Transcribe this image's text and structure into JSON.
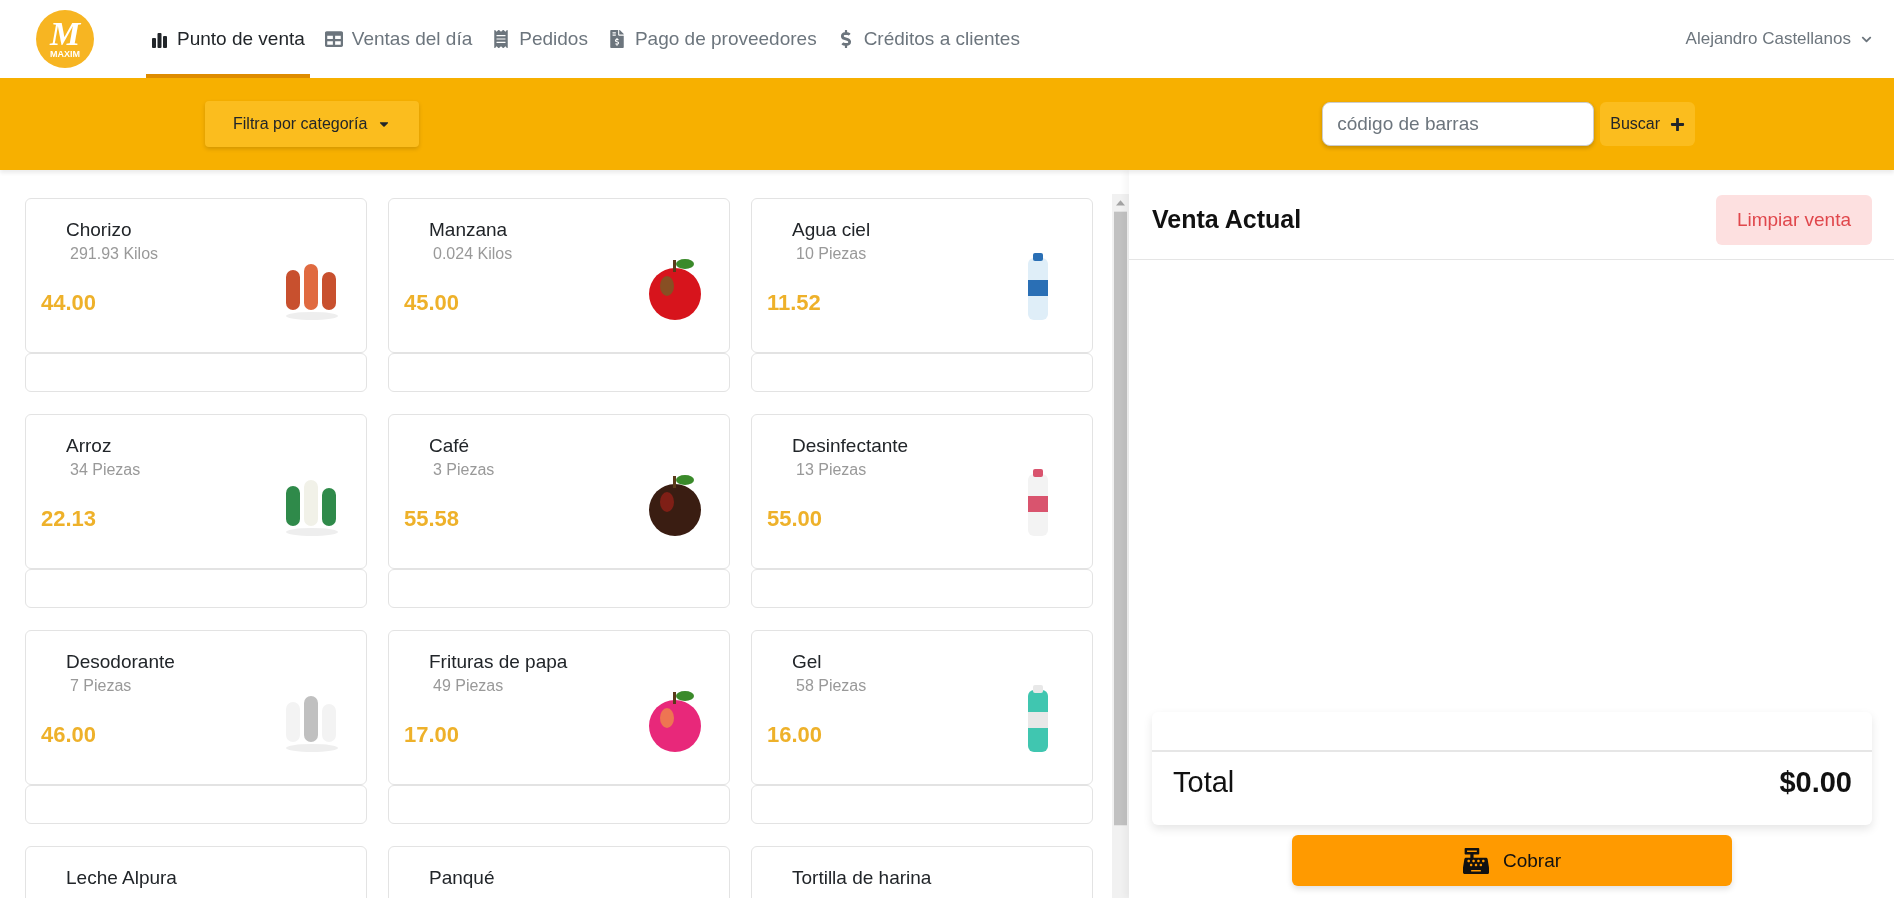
{
  "logo": {
    "letter": "M",
    "caption": "MAXIM"
  },
  "nav": [
    {
      "label": "Punto de venta",
      "selected": true
    },
    {
      "label": "Ventas del día",
      "selected": false
    },
    {
      "label": "Pedidos",
      "selected": false
    },
    {
      "label": "Pago de proveedores",
      "selected": false
    },
    {
      "label": "Créditos a clientes",
      "selected": false
    }
  ],
  "user": {
    "name": "Alejandro Castellanos"
  },
  "toolbar": {
    "filter": "Filtra por categoría",
    "search": {
      "placeholder": "código de barras"
    },
    "search_button": "Buscar"
  },
  "products": [
    {
      "name": "Chorizo",
      "stock": "291.93 Kilos",
      "price": "44.00"
    },
    {
      "name": "Manzana",
      "stock": "0.024 Kilos",
      "price": "45.00"
    },
    {
      "name": "Agua ciel",
      "stock": "10 Piezas",
      "price": "11.52"
    },
    {
      "name": "Arroz",
      "stock": "34 Piezas",
      "price": "22.13"
    },
    {
      "name": "Café",
      "stock": "3 Piezas",
      "price": "55.58"
    },
    {
      "name": "Desinfectante",
      "stock": "13 Piezas",
      "price": "55.00"
    },
    {
      "name": "Desodorante",
      "stock": "7 Piezas",
      "price": "46.00"
    },
    {
      "name": "Frituras de papa",
      "stock": "49 Piezas",
      "price": "17.00"
    },
    {
      "name": "Gel",
      "stock": "58 Piezas",
      "price": "16.00"
    },
    {
      "name": "Leche Alpura"
    },
    {
      "name": "Panqué"
    },
    {
      "name": "Tortilla de harina"
    }
  ],
  "sale": {
    "title": "Venta Actual",
    "clear_button": "Limpiar venta",
    "total_label": "Total",
    "total_value": "$0.00",
    "charge_button": "Cobrar"
  }
}
